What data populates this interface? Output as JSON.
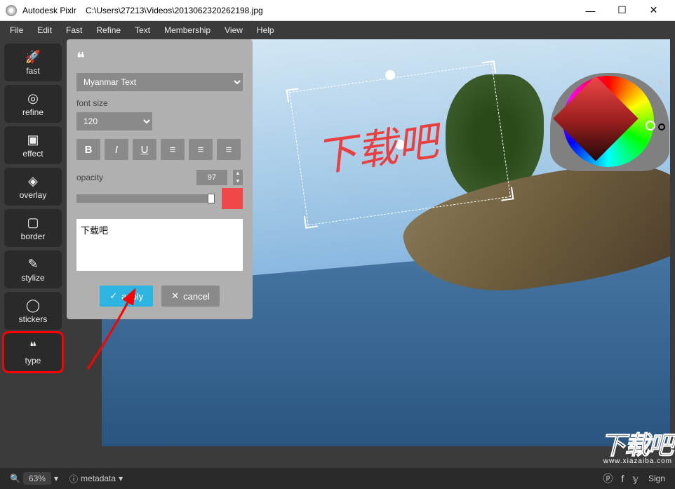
{
  "titlebar": {
    "app_name": "Autodesk Pixlr",
    "file_path": "C:\\Users\\27213\\Videos\\2013062320262198.jpg"
  },
  "menu": {
    "items": [
      "File",
      "Edit",
      "Fast",
      "Refine",
      "Text",
      "Membership",
      "View",
      "Help"
    ]
  },
  "toolbar": {
    "items": [
      {
        "label": "fast",
        "icon": "🚀"
      },
      {
        "label": "refine",
        "icon": "◎"
      },
      {
        "label": "effect",
        "icon": "▣"
      },
      {
        "label": "overlay",
        "icon": "◈"
      },
      {
        "label": "border",
        "icon": "▢"
      },
      {
        "label": "stylize",
        "icon": "✎"
      },
      {
        "label": "stickers",
        "icon": "◯"
      },
      {
        "label": "type",
        "icon": "❝"
      }
    ],
    "selected": "type"
  },
  "type_panel": {
    "font_select": "Myanmar Text",
    "font_size_label": "font size",
    "font_size": "120",
    "opacity_label": "opacity",
    "opacity_value": "97",
    "text_value": "下载吧",
    "apply_label": "apply",
    "cancel_label": "cancel",
    "color": "#f04848"
  },
  "canvas": {
    "text_overlay": "下载吧"
  },
  "statusbar": {
    "zoom": "63%",
    "metadata_label": "metadata",
    "sign_label": "Sign"
  },
  "watermark": {
    "main": "下载吧",
    "sub": "www.xiazaiba.com"
  }
}
